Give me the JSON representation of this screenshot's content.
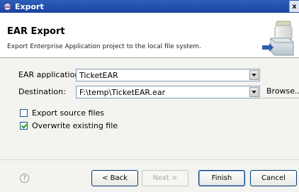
{
  "window": {
    "title": "Export",
    "close_glyph": "x"
  },
  "header": {
    "title": "EAR Export",
    "description": "Export Enterprise Application project to the local file system.",
    "icon": "export-wizard-icon"
  },
  "form": {
    "ear_application": {
      "label": "EAR application:",
      "value": "TicketEAR"
    },
    "destination": {
      "label": "Destination:",
      "value": "F:\\temp\\TicketEAR.ear",
      "browse_label": "Browse..."
    },
    "options": [
      {
        "label": "Export source files",
        "checked": false
      },
      {
        "label": "Overwrite existing file",
        "checked": true
      }
    ]
  },
  "footer": {
    "help_glyph": "?",
    "back_label": "< Back",
    "next_label": "Next >",
    "finish_label": "Finish",
    "cancel_label": "Cancel"
  }
}
